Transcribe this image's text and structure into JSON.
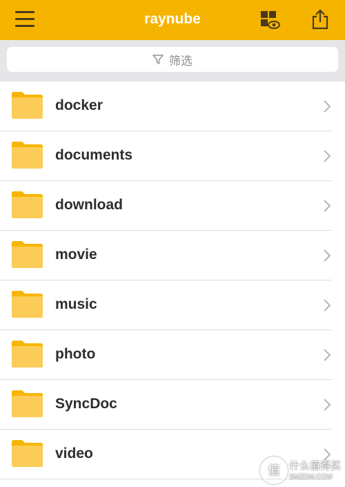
{
  "header": {
    "title": "raynube",
    "background_color": "#f5b400",
    "menu_icon": "hamburger-menu-icon",
    "view_icon": "grid-view-eye-icon",
    "share_icon": "share-export-icon"
  },
  "filter": {
    "label": "筛选",
    "icon": "filter-funnel-icon"
  },
  "folders": [
    {
      "name": "docker"
    },
    {
      "name": "documents"
    },
    {
      "name": "download"
    },
    {
      "name": "movie"
    },
    {
      "name": "music"
    },
    {
      "name": "photo"
    },
    {
      "name": "SyncDoc"
    },
    {
      "name": "video"
    }
  ],
  "folder_icon": "folder-icon",
  "row_chevron_icon": "chevron-right-icon",
  "folder_color": "#f9c84a",
  "watermark": {
    "badge": "值",
    "line1": "什么值得买",
    "line2": "SMZDM.COM"
  }
}
